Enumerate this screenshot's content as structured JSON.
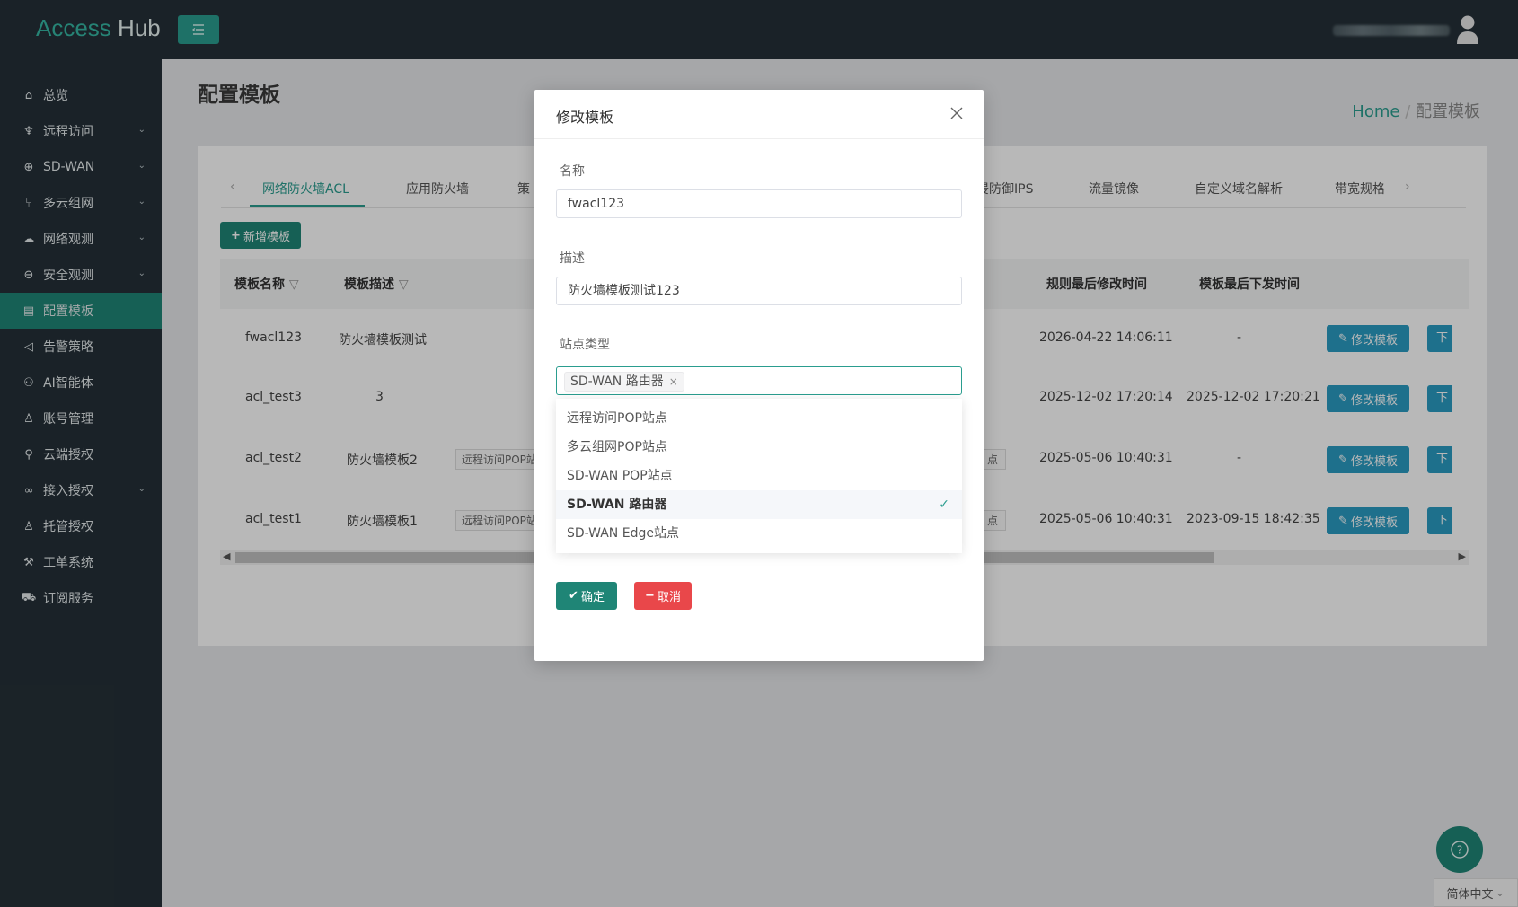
{
  "app": {
    "brand_access": "Access",
    "brand_hub": "Hub"
  },
  "sidebar": {
    "items": [
      {
        "label": "总览",
        "icon": "home-icon",
        "chevron": false
      },
      {
        "label": "远程访问",
        "icon": "rocket-icon",
        "chevron": true
      },
      {
        "label": "SD-WAN",
        "icon": "globe-icon",
        "chevron": true
      },
      {
        "label": "多云组网",
        "icon": "branch-icon",
        "chevron": true
      },
      {
        "label": "网络观测",
        "icon": "cloud-icon",
        "chevron": true
      },
      {
        "label": "安全观测",
        "icon": "minus-circle-icon",
        "chevron": true
      },
      {
        "label": "配置模板",
        "icon": "file-icon",
        "chevron": false,
        "active": true
      },
      {
        "label": "告警策略",
        "icon": "megaphone-icon",
        "chevron": false
      },
      {
        "label": "AI智能体",
        "icon": "agent-icon",
        "chevron": false
      },
      {
        "label": "账号管理",
        "icon": "users-icon",
        "chevron": false
      },
      {
        "label": "云端授权",
        "icon": "key-icon",
        "chevron": false
      },
      {
        "label": "接入授权",
        "icon": "link-icon",
        "chevron": true
      },
      {
        "label": "托管授权",
        "icon": "user-icon",
        "chevron": false
      },
      {
        "label": "工单系统",
        "icon": "wrench-icon",
        "chevron": false
      },
      {
        "label": "订阅服务",
        "icon": "cart-icon",
        "chevron": false
      }
    ]
  },
  "page": {
    "title": "配置模板",
    "breadcrumb_home": "Home",
    "breadcrumb_sep": "/",
    "breadcrumb_current": "配置模板"
  },
  "tabs": [
    "网络防火墙ACL",
    "应用防火墙",
    "策",
    "入侵防御IPS",
    "流量镜像",
    "自定义域名解析",
    "带宽规格"
  ],
  "toolbar": {
    "add_label": "新增模板"
  },
  "table": {
    "headers": [
      "模板名称",
      "模板描述",
      "规则最后修改时间",
      "模板最后下发时间"
    ],
    "rows": [
      {
        "name": "fwacl123",
        "desc": "防火墙模板测试",
        "tag": "",
        "tag_right": "",
        "modified": "2026-04-22 14:06:11",
        "deployed": "-"
      },
      {
        "name": "acl_test3",
        "desc": "3",
        "tag": "",
        "tag_right": "",
        "modified": "2025-12-02 17:20:14",
        "deployed": "2025-12-02 17:20:21"
      },
      {
        "name": "acl_test2",
        "desc": "防火墙模板2",
        "tag": "远程访问POP站",
        "tag_right": "点",
        "modified": "2025-05-06 10:40:31",
        "deployed": "-"
      },
      {
        "name": "acl_test1",
        "desc": "防火墙模板1",
        "tag": "远程访问POP站",
        "tag_right": "点",
        "modified": "2025-05-06 10:40:31",
        "deployed": "2023-09-15 18:42:35"
      }
    ],
    "edit_label": "修改模板",
    "down_label": "下发"
  },
  "modal": {
    "title": "修改模板",
    "name_label": "名称",
    "name_value": "fwacl123",
    "desc_label": "描述",
    "desc_value": "防火墙模板测试123",
    "site_type_label": "站点类型",
    "selected_chip": "SD-WAN 路由器",
    "options": [
      "远程访问POP站点",
      "多云组网POP站点",
      "SD-WAN POP站点",
      "SD-WAN 路由器",
      "SD-WAN Edge站点"
    ],
    "selected_option_index": 3,
    "ok_label": "确定",
    "cancel_label": "取消"
  },
  "footer": {
    "language": "简体中文"
  }
}
